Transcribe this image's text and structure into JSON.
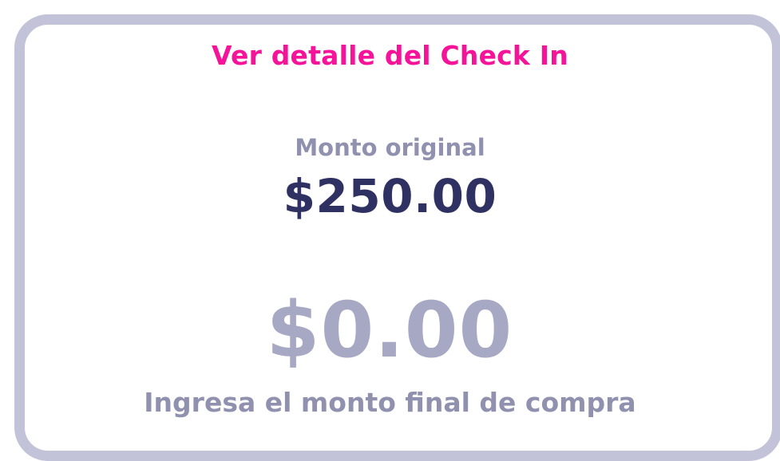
{
  "header": {
    "link_label": "Ver detalle del Check In"
  },
  "original": {
    "label": "Monto original",
    "amount": "$250.00"
  },
  "final": {
    "placeholder": "$0.00",
    "hint": "Ingresa el monto final de compra"
  },
  "colors": {
    "accent": "#f5139a",
    "border": "#c2c3d8",
    "primary_text": "#2f3163",
    "muted_text": "#8f91ae",
    "placeholder_text": "#a6a8c4"
  }
}
